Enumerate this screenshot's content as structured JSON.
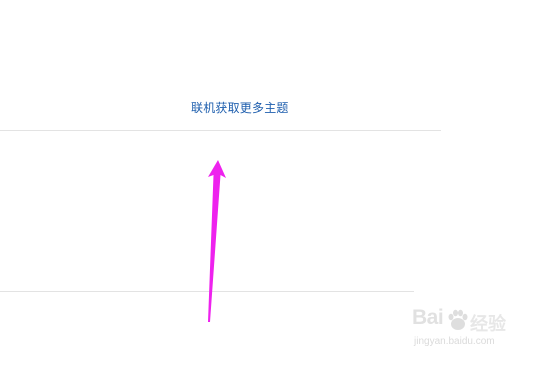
{
  "content": {
    "online_themes_link": "联机获取更多主题"
  },
  "watermark": {
    "brand_left": "Bai",
    "brand_right": "经验",
    "url": "jingyan.baidu.com"
  },
  "colors": {
    "link": "#1f5fae",
    "divider": "#e3e3e3",
    "arrow": "#ee22ee"
  },
  "icons": {
    "annotation": "up-arrow-icon",
    "watermark_logo": "baidu-paw-icon"
  }
}
